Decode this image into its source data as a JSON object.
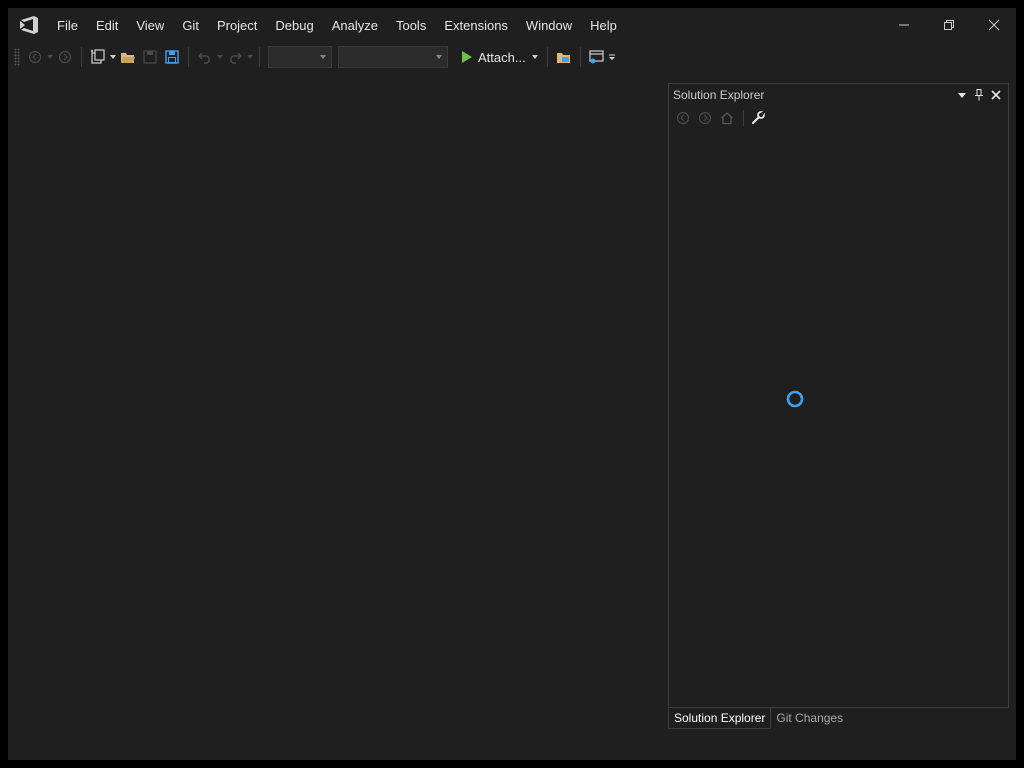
{
  "menu": {
    "items": [
      {
        "label": "File"
      },
      {
        "label": "Edit"
      },
      {
        "label": "View"
      },
      {
        "label": "Git"
      },
      {
        "label": "Project"
      },
      {
        "label": "Debug"
      },
      {
        "label": "Analyze"
      },
      {
        "label": "Tools"
      },
      {
        "label": "Extensions"
      },
      {
        "label": "Window"
      },
      {
        "label": "Help"
      }
    ]
  },
  "toolbar": {
    "attach_label": "Attach...",
    "config_value": "",
    "platform_value": ""
  },
  "solution_explorer": {
    "title": "Solution Explorer",
    "loading": true
  },
  "panel_tabs": [
    {
      "label": "Solution Explorer",
      "active": true
    },
    {
      "label": "Git Changes",
      "active": false
    }
  ],
  "colors": {
    "accent_blue": "#3fa1f5",
    "play_green": "#6cc24a",
    "folder_yellow": "#dcb67a"
  },
  "icons": {
    "logo": "visual-studio-logo-icon",
    "minimize": "minimize-icon",
    "restore": "restore-icon",
    "close": "close-icon"
  }
}
